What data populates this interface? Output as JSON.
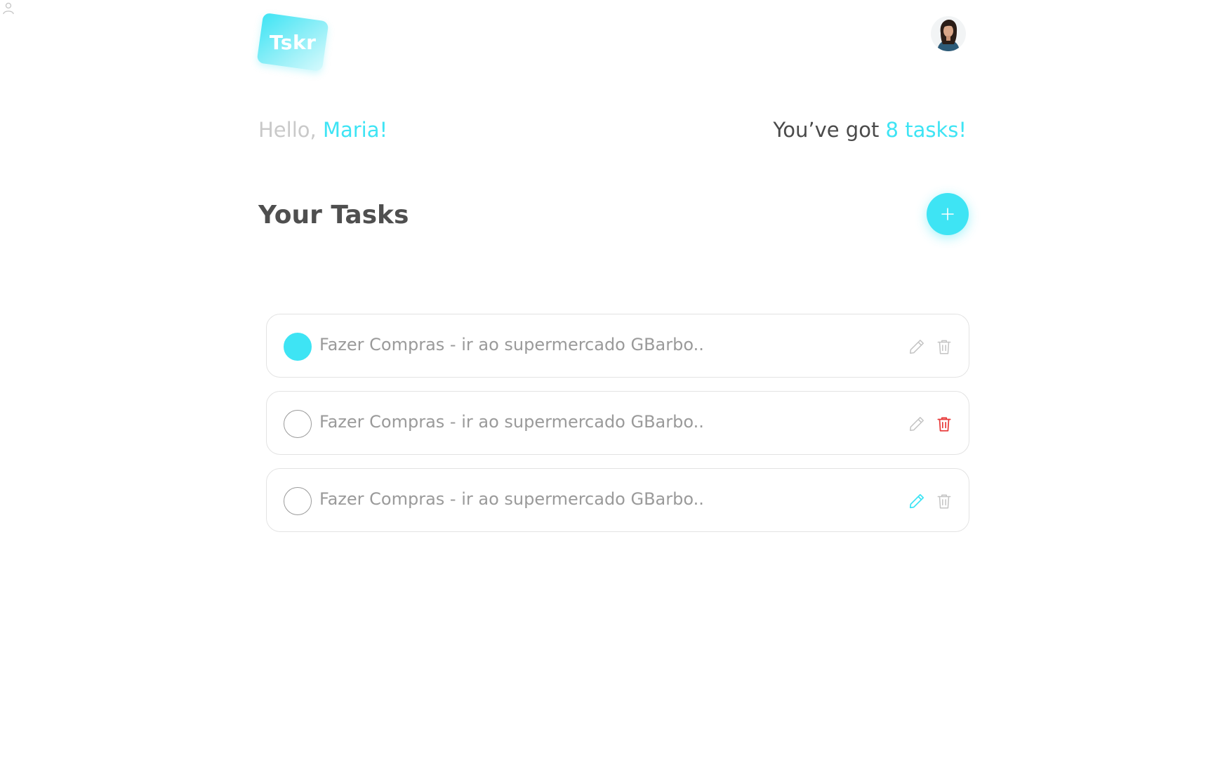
{
  "header": {
    "logo_text": "Tskr",
    "avatar_alt": "Maria"
  },
  "greeting": {
    "prefix": "Hello, ",
    "name": "Maria!"
  },
  "task_count": {
    "prefix": "You’ve got ",
    "count": "8 tasks!"
  },
  "section": {
    "title": "Your Tasks"
  },
  "tasks": [
    {
      "text": "Fazer Compras - ir ao supermercado GBarbo..",
      "done": true,
      "edit_state": "default",
      "delete_state": "default"
    },
    {
      "text": "Fazer Compras - ir ao supermercado GBarbo..",
      "done": false,
      "edit_state": "default",
      "delete_state": "hover"
    },
    {
      "text": "Fazer Compras - ir ao supermercado GBarbo..",
      "done": false,
      "edit_state": "hover",
      "delete_state": "default"
    }
  ],
  "colors": {
    "accent": "#3ee4f4",
    "danger": "#e83a3a",
    "muted": "#c4c4c4",
    "text_dark": "#4f4f4f"
  },
  "icons": {
    "corner": "user-outline-icon",
    "add": "plus-icon",
    "edit": "pencil-icon",
    "delete": "trash-icon"
  }
}
